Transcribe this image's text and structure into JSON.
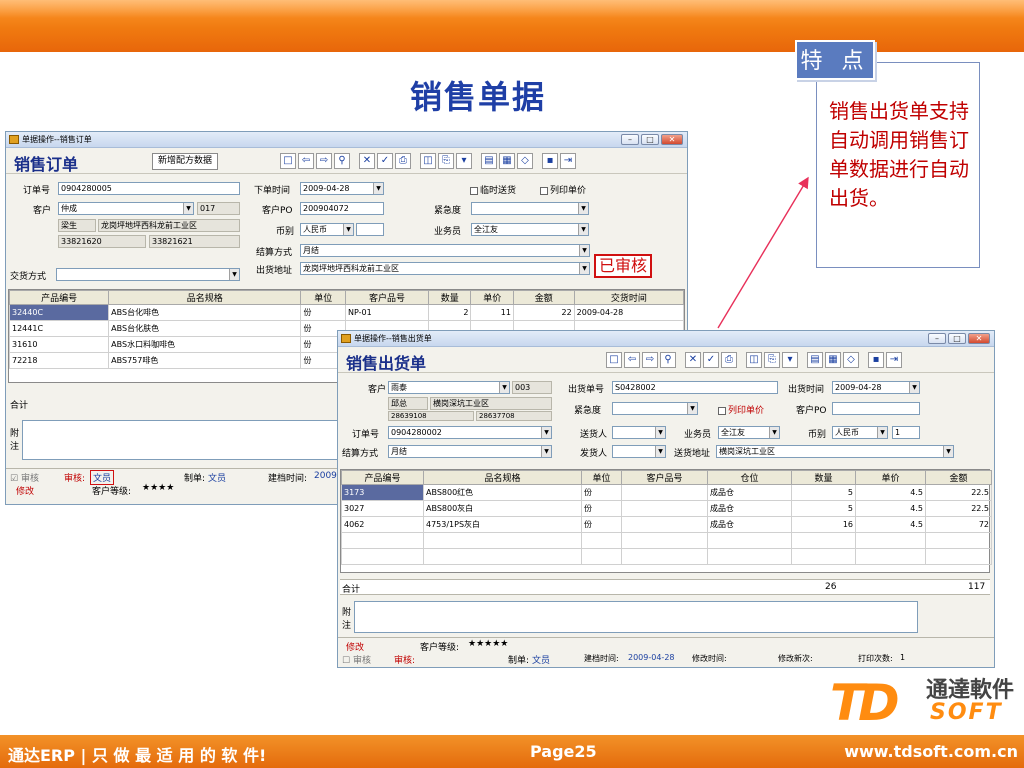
{
  "slide": {
    "title": "销售单据",
    "feature_tag": "特 点",
    "feature_text": "销售出货单支持自动调用销售订单数据进行自动出货。",
    "footer_left": "通达ERP | 只 做 最 适 用 的 软 件!",
    "footer_page": "Page25",
    "footer_url": "www.tdsoft.com.cn",
    "logo_td": "TD",
    "logo_cn": "通達軟件",
    "logo_soft": "SOFT",
    "colors": {
      "band": "#f07a10",
      "title": "#1f3fa6",
      "feature_text": "#c00000",
      "tag_bg": "#5a7bbf"
    }
  },
  "order_window": {
    "title": "单据操作--销售订单",
    "doc_title": "销售订单",
    "new_formula_btn": "新增配方数据",
    "icons": [
      "new-icon",
      "back-icon",
      "forward-icon",
      "search-icon",
      "delete-icon",
      "check-icon",
      "print-icon",
      "preview-icon",
      "print-setup-icon",
      "save-icon",
      "exit-icon"
    ],
    "order_no_label": "订单号",
    "order_no": "0904280005",
    "customer_label": "客户",
    "customer": "仲成",
    "customer_code": "017",
    "contact": "梁生",
    "address": "龙岗坪地坪西科龙前工业区",
    "phone1": "33821620",
    "phone2": "33821621",
    "order_time_label": "下单时间",
    "order_time": "2009-04-28",
    "customer_po_label": "客户PO",
    "customer_po": "200904072",
    "currency_label": "币别",
    "currency": "人民币",
    "settle_label": "结算方式",
    "settle": "月结",
    "ship_addr_label": "出货地址",
    "ship_addr": "龙岗坪地坪西科龙前工业区",
    "temp_ship_label": "临时送货",
    "print_price_label": "列印单价",
    "urgency_label": "紧急度",
    "salesman_label": "业务员",
    "salesman": "全江友",
    "deliver_label": "交货方式",
    "approved_stamp": "已审核",
    "columns": [
      "产品编号",
      "品名规格",
      "单位",
      "客户品号",
      "数量",
      "单价",
      "金额",
      "交货时间"
    ],
    "rows": [
      [
        "32440C",
        "ABS台化啡色",
        "份",
        "NP-01",
        "2",
        "11",
        "22",
        "2009-04-28"
      ],
      [
        "12441C",
        "ABS台化肤色",
        "份",
        "",
        "",
        "",
        "",
        ""
      ],
      [
        "31610",
        "ABS水口料咖啡色",
        "份",
        "",
        "",
        "",
        "",
        ""
      ],
      [
        "72218",
        "ABS757啡色",
        "份",
        "",
        "",
        "",
        "",
        ""
      ]
    ],
    "total_label": "合计",
    "note_label": "附注",
    "status_check": "审核",
    "status_reviewer_label": "审核:",
    "status_reviewer": "文员",
    "status_maker_label": "制单:",
    "status_maker": "文员",
    "status_created_label": "建档时间:",
    "status_created": "2009",
    "modify_label": "修改",
    "grade_label": "客户等级:",
    "grade": "★★★★"
  },
  "ship_window": {
    "title": "单据操作--销售出货单",
    "doc_title": "销售出货单",
    "customer_label": "客户",
    "customer": "雨泰",
    "customer_code": "003",
    "contact": "邱总",
    "address": "横岗深坑工业区",
    "phone1": "28639108",
    "phone2": "28637708",
    "order_no_label": "订单号",
    "order_no": "0904280002",
    "settle_label": "结算方式",
    "settle": "月结",
    "ship_no_label": "出货单号",
    "ship_no": "S0428002",
    "urgency_label": "紧急度",
    "deliverer_label": "送货人",
    "sender_label": "发货人",
    "print_price_label": "列印单价",
    "salesman_label": "业务员",
    "salesman": "全江友",
    "ship_addr_label": "送货地址",
    "ship_addr": "横岗深坑工业区",
    "ship_time_label": "出货时间",
    "ship_time": "2009-04-28",
    "customer_po_label": "客户PO",
    "currency_label": "币别",
    "currency": "人民币",
    "rate": "1",
    "columns": [
      "产品编号",
      "品名规格",
      "单位",
      "客户品号",
      "仓位",
      "数量",
      "单价",
      "金额"
    ],
    "rows": [
      [
        "3173",
        "ABS800红色",
        "份",
        "",
        "成品仓",
        "5",
        "4.5",
        "22.5"
      ],
      [
        "3027",
        "ABS800灰白",
        "份",
        "",
        "成品仓",
        "5",
        "4.5",
        "22.5"
      ],
      [
        "4062",
        "4753/1PS灰白",
        "份",
        "",
        "成品仓",
        "16",
        "4.5",
        "72"
      ]
    ],
    "total_label": "合计",
    "total_qty": "26",
    "total_amount": "117",
    "note_label": "附注",
    "modify_label": "修改",
    "grade_label": "客户等级:",
    "grade": "★★★★★",
    "status_check": "审核",
    "status_reviewer_label": "审核:",
    "status_maker_label": "制单:",
    "status_maker": "文员",
    "status_created_label": "建档时间:",
    "status_created": "2009-04-28",
    "status_modified_label": "修改时间:",
    "status_mod_count_label": "修改新次:",
    "status_print_label": "打印次数:",
    "status_print_count": "1"
  }
}
